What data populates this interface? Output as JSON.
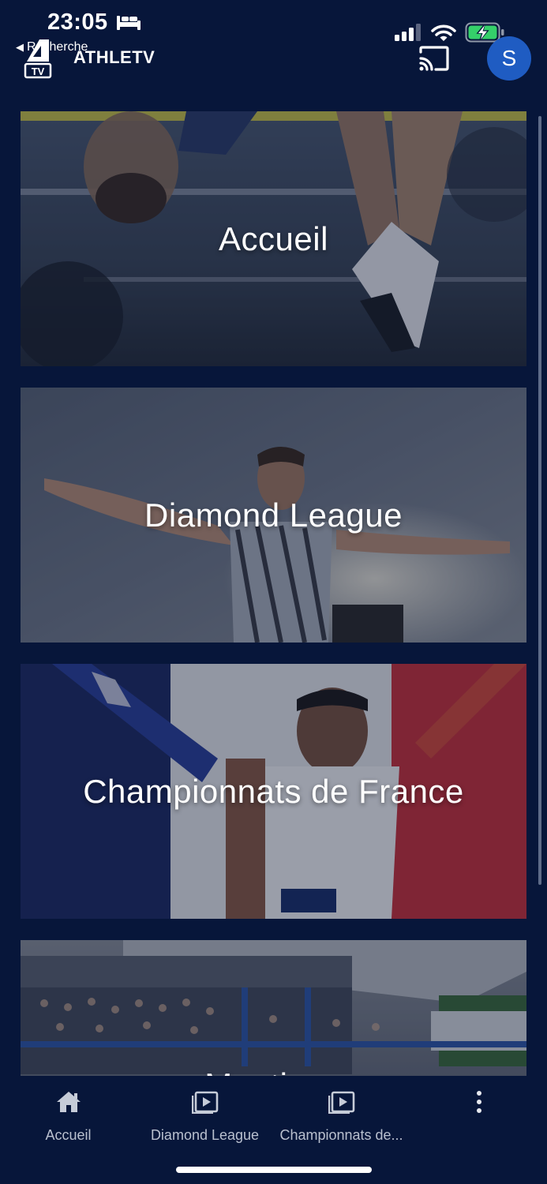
{
  "status_bar": {
    "time": "23:05",
    "back_label": "Recherche",
    "icons": [
      "bed-icon",
      "signal-icon",
      "wifi-icon",
      "battery-charging-icon"
    ]
  },
  "header": {
    "logo_text": "TV",
    "title": "ATHLETV",
    "cast_icon": "cast-icon",
    "avatar_initial": "S"
  },
  "cards": [
    {
      "label": "Accueil"
    },
    {
      "label": "Diamond League"
    },
    {
      "label": "Championnats de France"
    },
    {
      "label": "Meetings"
    }
  ],
  "tabbar": {
    "tabs": [
      {
        "label": "Accueil",
        "icon": "home-icon"
      },
      {
        "label": "Diamond League",
        "icon": "play-box-icon"
      },
      {
        "label": "Championnats de...",
        "icon": "play-box-icon"
      },
      {
        "label": "",
        "icon": "more-vertical-icon"
      }
    ]
  },
  "colors": {
    "background": "#07163a",
    "avatar": "#1f5cc2",
    "battery": "#35d06a",
    "tab_label": "#b9c0cf"
  }
}
